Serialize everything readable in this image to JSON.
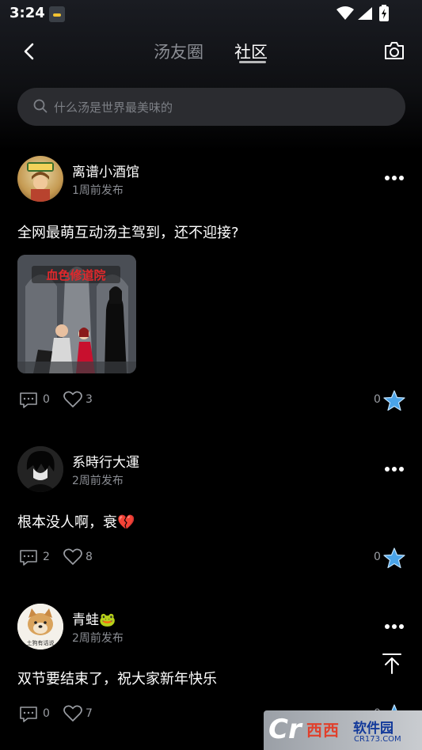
{
  "status_bar": {
    "time": "3:24"
  },
  "header": {
    "tabs": [
      {
        "label": "汤友圈",
        "active": false
      },
      {
        "label": "社区",
        "active": true
      }
    ]
  },
  "search": {
    "placeholder": "什么汤是世界最美味的"
  },
  "posts": [
    {
      "username": "离谱小酒馆",
      "time": "1周前发布",
      "text": "全网最萌互动汤主驾到，还不迎接?",
      "has_image": true,
      "image_caption": "血色修道院",
      "comments": "0",
      "likes": "3",
      "favorites": "0"
    },
    {
      "username": "系時行大運",
      "time": "2周前发布",
      "text": "根本没人啊，衰",
      "emoji": "💔",
      "comments": "2",
      "likes": "8",
      "favorites": "0"
    },
    {
      "username": "青蛙🐸",
      "time": "2周前发布",
      "text": "双节要结束了，祝大家新年快乐",
      "avatar_caption": "土狗有话说",
      "comments": "0",
      "likes": "7",
      "favorites": "0"
    }
  ],
  "watermark": {
    "main": "西西",
    "secondary": "软件园",
    "url": "CR173.COM"
  },
  "colors": {
    "background": "#000000",
    "search_bg": "#2b2c30",
    "muted": "#8a8d93",
    "star": "#4aa3e8"
  }
}
